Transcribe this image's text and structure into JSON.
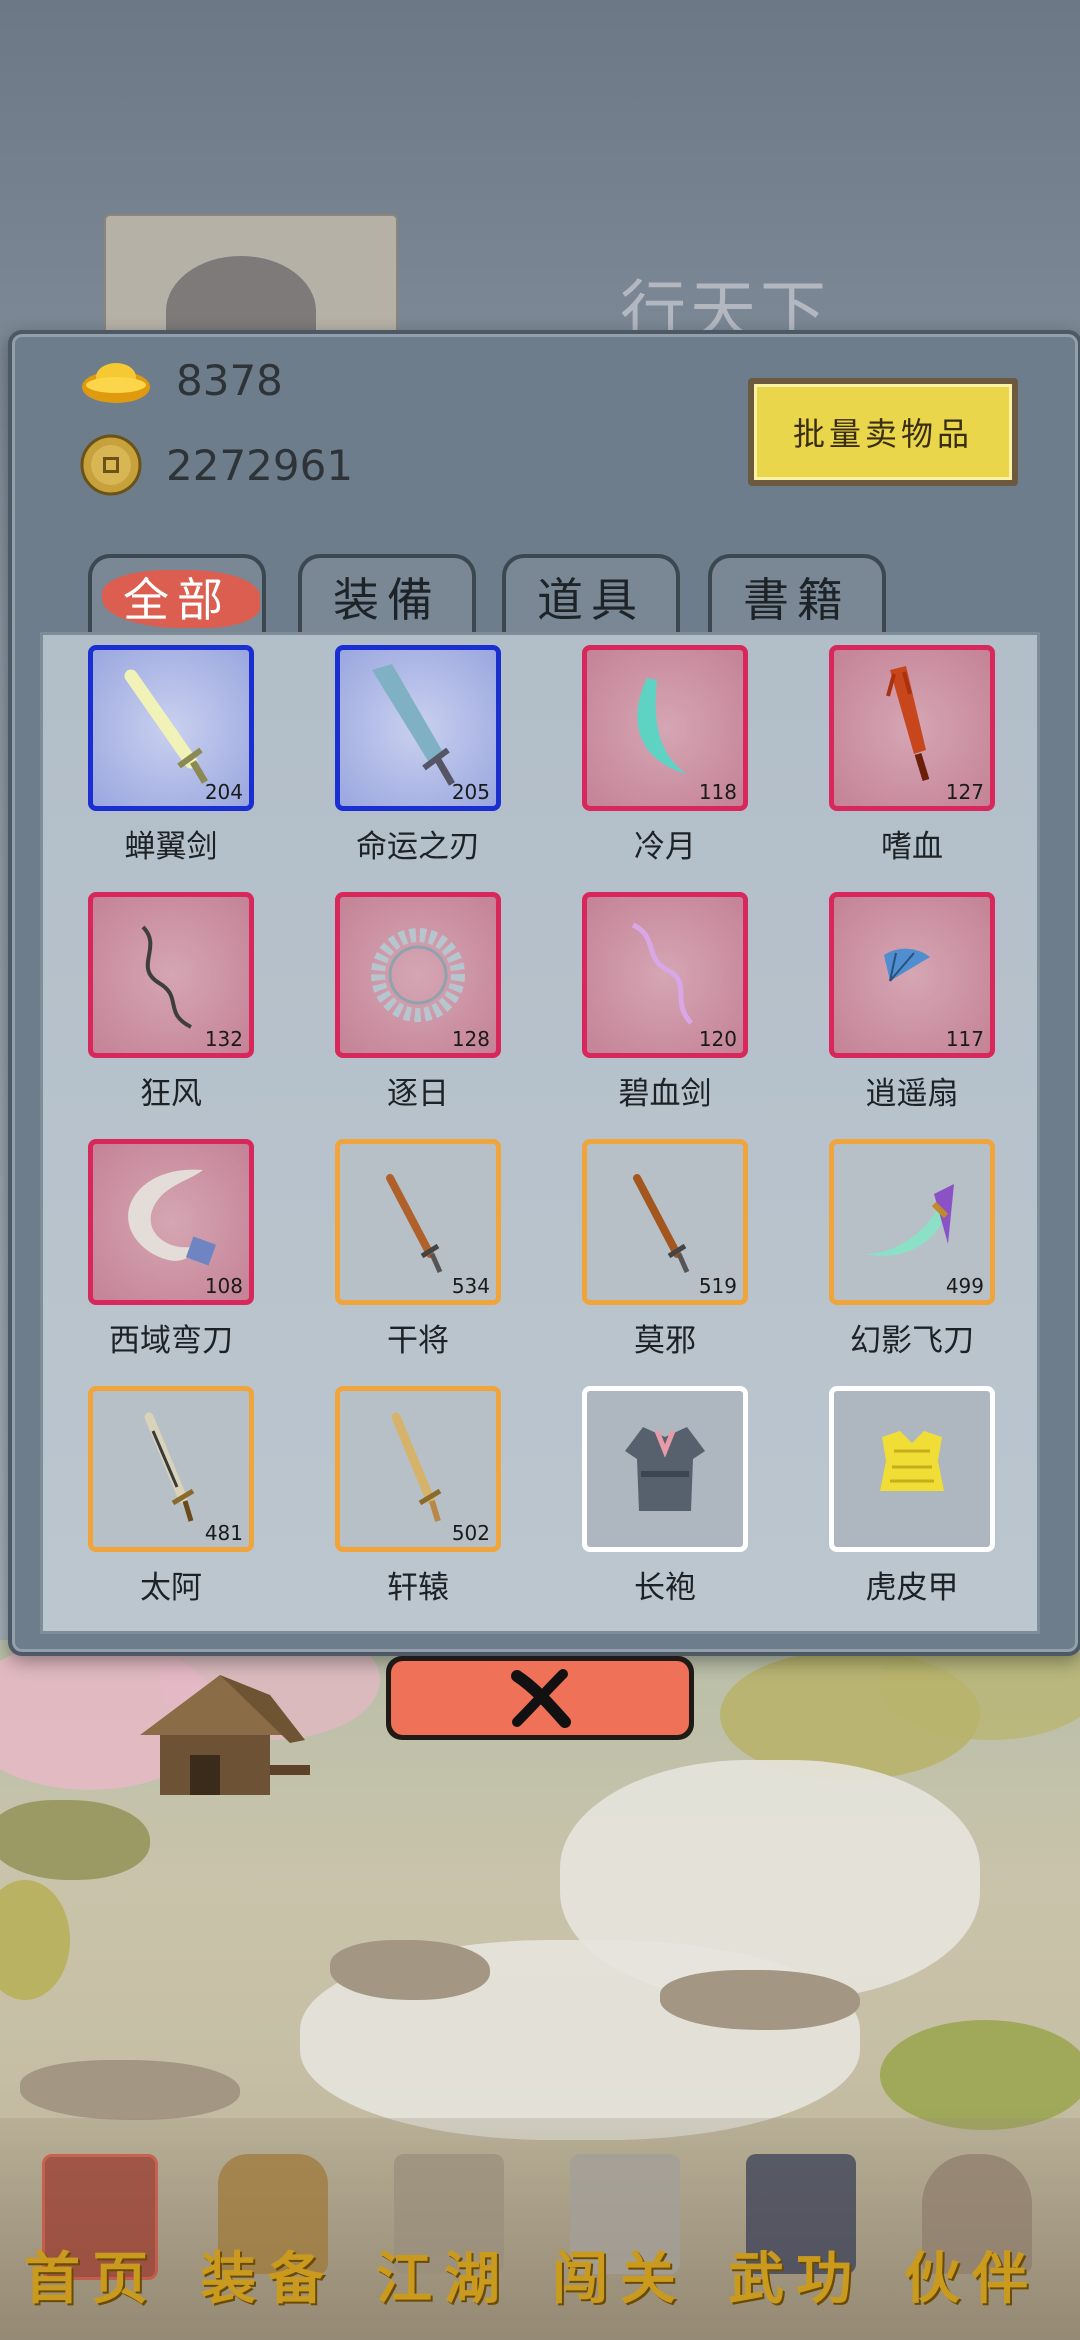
{
  "background": {
    "heading": "行天下"
  },
  "currency": {
    "gold": "8378",
    "coins": "2272961"
  },
  "sell_all_label": "批量卖物品",
  "tabs": [
    {
      "label": "全部",
      "active": true
    },
    {
      "label": "装備",
      "active": false
    },
    {
      "label": "道具",
      "active": false
    },
    {
      "label": "書籍",
      "active": false
    }
  ],
  "items": [
    {
      "name": "蝉翼剑",
      "level": "204",
      "rarity": "blue",
      "icon": "straight-sword-icon"
    },
    {
      "name": "命运之刃",
      "level": "205",
      "rarity": "blue",
      "icon": "broad-blade-icon"
    },
    {
      "name": "冷月",
      "level": "118",
      "rarity": "red",
      "icon": "crescent-blade-icon"
    },
    {
      "name": "嗜血",
      "level": "127",
      "rarity": "red",
      "icon": "blood-sword-icon"
    },
    {
      "name": "狂风",
      "level": "132",
      "rarity": "red",
      "icon": "whip-icon"
    },
    {
      "name": "逐日",
      "level": "128",
      "rarity": "red",
      "icon": "sun-ring-icon"
    },
    {
      "name": "碧血剑",
      "level": "120",
      "rarity": "red",
      "icon": "serpent-sword-icon"
    },
    {
      "name": "逍遥扇",
      "level": "117",
      "rarity": "red",
      "icon": "fan-icon"
    },
    {
      "name": "西域弯刀",
      "level": "108",
      "rarity": "red",
      "icon": "curved-scimitar-icon"
    },
    {
      "name": "干将",
      "level": "534",
      "rarity": "orange",
      "icon": "bronze-sword-icon"
    },
    {
      "name": "莫邪",
      "level": "519",
      "rarity": "orange",
      "icon": "bronze-sword-icon"
    },
    {
      "name": "幻影飞刀",
      "level": "499",
      "rarity": "orange",
      "icon": "flying-knife-icon"
    },
    {
      "name": "太阿",
      "level": "481",
      "rarity": "orange",
      "icon": "ornate-sword-icon"
    },
    {
      "name": "轩辕",
      "level": "502",
      "rarity": "orange",
      "icon": "golden-sword-icon"
    },
    {
      "name": "长袍",
      "level": "",
      "rarity": "white",
      "icon": "robe-icon"
    },
    {
      "name": "虎皮甲",
      "level": "",
      "rarity": "white",
      "icon": "armor-vest-icon"
    }
  ],
  "peek_row_colors": [
    "#2a9a3a",
    "#2a9a3a",
    "#1b2fd0",
    "#1b2fd0"
  ],
  "colors": {
    "rarity_blue": "#1b2fd0",
    "rarity_red": "#d8275a",
    "rarity_orange": "#f0a43c",
    "rarity_white": "#ffffff",
    "close_button": "#ee7158",
    "nav_label": "#c99a1e"
  },
  "nav": [
    {
      "label": "首页",
      "icon": "house-icon"
    },
    {
      "label": "装备",
      "icon": "armor-icon"
    },
    {
      "label": "江湖",
      "icon": "scroll-icon"
    },
    {
      "label": "闯关",
      "icon": "crossed-swords-icon"
    },
    {
      "label": "武功",
      "icon": "book-icon"
    },
    {
      "label": "伙伴",
      "icon": "companions-icon"
    }
  ]
}
